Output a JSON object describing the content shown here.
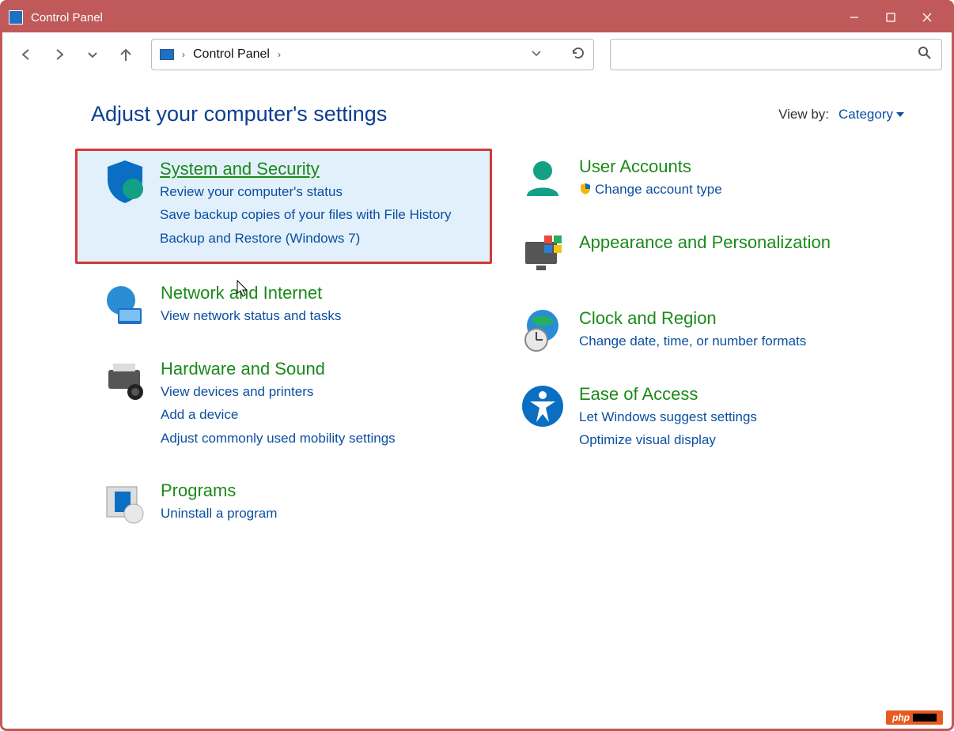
{
  "window": {
    "title": "Control Panel"
  },
  "address": {
    "crumb": "Control Panel"
  },
  "header": {
    "title": "Adjust your computer's settings"
  },
  "viewby": {
    "label": "View by:",
    "value": "Category"
  },
  "left": {
    "system": {
      "title": "System and Security",
      "links": [
        "Review your computer's status",
        "Save backup copies of your files with File History",
        "Backup and Restore (Windows 7)"
      ]
    },
    "network": {
      "title": "Network and Internet",
      "links": [
        "View network status and tasks"
      ]
    },
    "hardware": {
      "title": "Hardware and Sound",
      "links": [
        "View devices and printers",
        "Add a device",
        "Adjust commonly used mobility settings"
      ]
    },
    "programs": {
      "title": "Programs",
      "links": [
        "Uninstall a program"
      ]
    }
  },
  "right": {
    "users": {
      "title": "User Accounts",
      "links": [
        "Change account type"
      ]
    },
    "appearance": {
      "title": "Appearance and Personalization",
      "links": []
    },
    "clock": {
      "title": "Clock and Region",
      "links": [
        "Change date, time, or number formats"
      ]
    },
    "ease": {
      "title": "Ease of Access",
      "links": [
        "Let Windows suggest settings",
        "Optimize visual display"
      ]
    }
  },
  "watermark": "php"
}
